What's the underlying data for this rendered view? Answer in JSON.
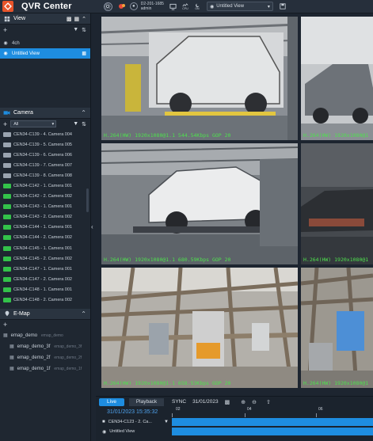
{
  "app": {
    "title": "QVR Center",
    "server_line1": "D2-201-1685",
    "server_line2": "admin",
    "status_labels": [
      "CPU",
      "ON"
    ]
  },
  "toolbar": {
    "current_view": "Untitled View"
  },
  "view_panel": {
    "title": "View",
    "items": [
      {
        "label": "4ch",
        "selected": false
      },
      {
        "label": "Untitled View",
        "selected": true
      }
    ]
  },
  "camera_panel": {
    "title": "Camera",
    "filter": "All",
    "items": [
      {
        "label": "CEN34-C139 - 4. Camera 004",
        "status": "gray"
      },
      {
        "label": "CEN34-C139 - 5. Camera 005",
        "status": "gray"
      },
      {
        "label": "CEN34-C139 - 6. Camera 006",
        "status": "gray"
      },
      {
        "label": "CEN34-C139 - 7. Camera 007",
        "status": "gray"
      },
      {
        "label": "CEN34-C139 - 8. Camera 008",
        "status": "gray"
      },
      {
        "label": "CEN34-C142 - 1. Camera 001",
        "status": "green"
      },
      {
        "label": "CEN34-C142 - 2. Camera 002",
        "status": "green"
      },
      {
        "label": "CEN34-C143 - 1. Camera 001",
        "status": "green"
      },
      {
        "label": "CEN34-C143 - 2. Camera 002",
        "status": "green"
      },
      {
        "label": "CEN34-C144 - 1. Camera 001",
        "status": "green"
      },
      {
        "label": "CEN34-C144 - 2. Camera 002",
        "status": "green"
      },
      {
        "label": "CEN34-C145 - 1. Camera 001",
        "status": "green"
      },
      {
        "label": "CEN34-C145 - 2. Camera 002",
        "status": "green"
      },
      {
        "label": "CEN34-C147 - 1. Camera 001",
        "status": "green"
      },
      {
        "label": "CEN34-C147 - 2. Camera 002",
        "status": "green"
      },
      {
        "label": "CEN34-C148 - 1. Camera 001",
        "status": "green"
      },
      {
        "label": "CEN34-C148 - 2. Camera 002",
        "status": "green"
      }
    ]
  },
  "emap_panel": {
    "title": "E-Map",
    "items": [
      {
        "label": "emap_demo",
        "sub": "emap_demo",
        "level": 0
      },
      {
        "label": "emap_demo_3f",
        "sub": "emap_demo_3f",
        "level": 1
      },
      {
        "label": "emap_demo_2f",
        "sub": "emap_demo_2f",
        "level": 1
      },
      {
        "label": "emap_demo_1f",
        "sub": "emap_demo_1f",
        "level": 1
      }
    ]
  },
  "grid": {
    "cells": [
      {
        "osd": "H.264(HW) 1920x1080@1.1 544.54Kbps GOP 20"
      },
      {
        "osd": "H.264(HW) 1920x1080@1"
      },
      {
        "osd": "H.264(HW) 1920x1080@1.1 680.59Kbps GOP 20"
      },
      {
        "osd": "H.264(HW) 1920x1080@1"
      },
      {
        "osd": "H.264(HW) 1920x1080@1.1 658.53Kbps GOP 20"
      },
      {
        "osd": "H.264(HW) 1920x1080@1"
      }
    ]
  },
  "timeline": {
    "live_label": "Live",
    "playback_label": "Playback",
    "sync_label": "SYNC",
    "date": "31/01/2023",
    "timestamp": "31/01/2023 15:35:32",
    "ticks": [
      "02",
      "04",
      "06"
    ],
    "track_label": "CEN34-C123 - 2. Ca...",
    "view_label": "Untitled View"
  }
}
